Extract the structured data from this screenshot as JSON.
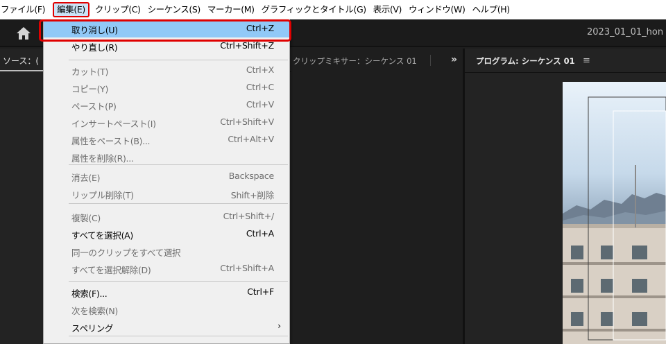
{
  "menubar": {
    "items": [
      "ファイル(F)",
      "編集(E)",
      "クリップ(C)",
      "シーケンス(S)",
      "マーカー(M)",
      "グラフィックとタイトル(G)",
      "表示(V)",
      "ウィンドウ(W)",
      "ヘルプ(H)"
    ],
    "active_index": 1
  },
  "header": {
    "project_title": "2023_01_01_hon",
    "home_icon": "home-icon"
  },
  "panels": {
    "source_tab": "ソース：(",
    "mixer_tab": "クリップミキサー：シーケンス 01",
    "overflow_icon": "»",
    "program_tab": "プログラム: シーケンス 01",
    "program_menu_icon": "≡"
  },
  "edit_menu": {
    "items": [
      {
        "label": "取り消し(U)",
        "shortcut": "Ctrl+Z",
        "enabled": true,
        "highlighted": true
      },
      {
        "label": "やり直し(R)",
        "shortcut": "Ctrl+Shift+Z",
        "enabled": true
      },
      {
        "label": "カット(T)",
        "shortcut": "Ctrl+X",
        "enabled": false
      },
      {
        "label": "コピー(Y)",
        "shortcut": "Ctrl+C",
        "enabled": false
      },
      {
        "label": "ペースト(P)",
        "shortcut": "Ctrl+V",
        "enabled": false
      },
      {
        "label": "インサートペースト(I)",
        "shortcut": "Ctrl+Shift+V",
        "enabled": false
      },
      {
        "label": "属性をペースト(B)...",
        "shortcut": "Ctrl+Alt+V",
        "enabled": false
      },
      {
        "label": "属性を削除(R)...",
        "shortcut": "",
        "enabled": false
      },
      {
        "label": "消去(E)",
        "shortcut": "Backspace",
        "enabled": false
      },
      {
        "label": "リップル削除(T)",
        "shortcut": "Shift+削除",
        "enabled": false
      },
      {
        "label": "複製(C)",
        "shortcut": "Ctrl+Shift+/",
        "enabled": false
      },
      {
        "label": "すべてを選択(A)",
        "shortcut": "Ctrl+A",
        "enabled": true
      },
      {
        "label": "同一のクリップをすべて選択",
        "shortcut": "",
        "enabled": false
      },
      {
        "label": "すべてを選択解除(D)",
        "shortcut": "Ctrl+Shift+A",
        "enabled": false
      },
      {
        "label": "検索(F)...",
        "shortcut": "Ctrl+F",
        "enabled": true
      },
      {
        "label": "次を検索(N)",
        "shortcut": "",
        "enabled": false
      },
      {
        "label": "スペリング",
        "shortcut": "",
        "enabled": true,
        "submenu": true
      }
    ]
  },
  "colors": {
    "highlight": "#91c9f7",
    "frame": "#e00000",
    "panel_bg": "#232323"
  }
}
